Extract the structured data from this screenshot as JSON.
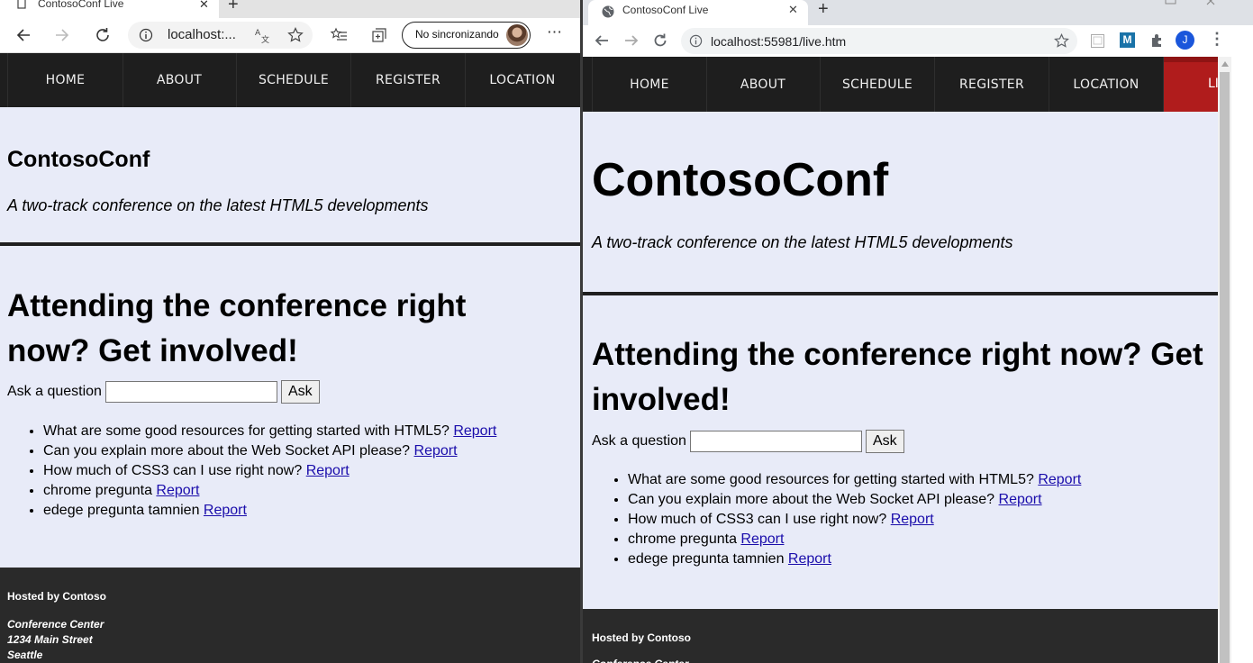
{
  "left_browser": {
    "tab": {
      "title": "ContosoConf Live",
      "close": "✕",
      "new_tab": "+"
    },
    "toolbar": {
      "url": "localhost:...",
      "profile_label": "No sincronizando",
      "menu": "⋯"
    }
  },
  "right_browser": {
    "tab": {
      "title": "ContosoConf Live",
      "close": "✕",
      "new_tab": "+"
    },
    "toolbar": {
      "url": "localhost:55981/live.htm",
      "extension_m": "M",
      "profile_initial": "J",
      "menu": "⋮"
    },
    "ribbon_text": "LI"
  },
  "site": {
    "nav": [
      "HOME",
      "ABOUT",
      "SCHEDULE",
      "REGISTER",
      "LOCATION"
    ],
    "title": "ContosoConf",
    "subtitle": "A two-track conference on the latest HTML5 developments",
    "heading": "Attending the conference right now? Get involved!",
    "ask_label": "Ask a question",
    "ask_value": "",
    "ask_button": "Ask",
    "questions": [
      "What are some good resources for getting started with HTML5?",
      "Can you explain more about the Web Socket API please?",
      "How much of CSS3 can I use right now?",
      "chrome pregunta",
      "edege pregunta tamnien"
    ],
    "report_label": "Report",
    "footer": {
      "host": "Hosted by Contoso",
      "address": [
        "Conference Center",
        "1234 Main Street",
        "Seattle"
      ]
    }
  },
  "colors": {
    "page_bg": "#e8ebf8",
    "nav_bg": "#1e1e1e",
    "footer_bg": "#2a2a2a",
    "ribbon": "#b01c1c",
    "link": "#1a0dab"
  }
}
